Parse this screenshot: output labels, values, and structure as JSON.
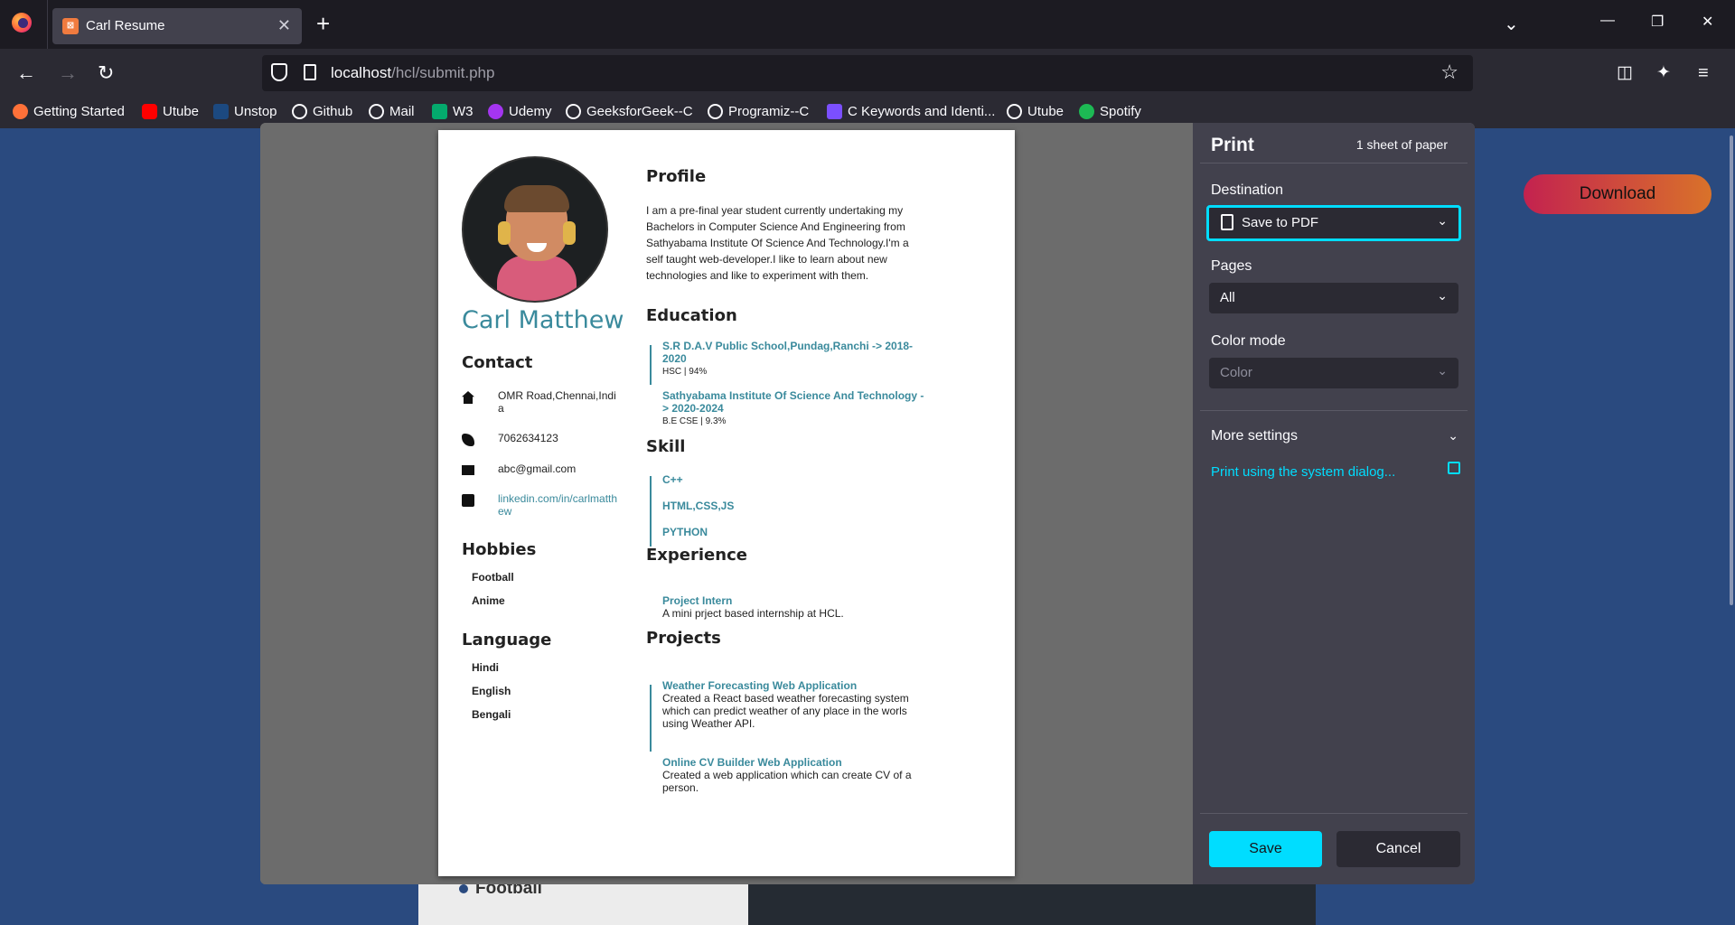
{
  "browser": {
    "tab_title": "Carl Resume",
    "tab_favicon": "xampp-icon",
    "tab_close": "✕",
    "new_tab": "+",
    "url_host": "localhost",
    "url_path": "/hcl/submit.php",
    "bookmarks": [
      {
        "label": "Getting Started",
        "icon": "firefox-icon",
        "color": "#ff7139"
      },
      {
        "label": "Utube",
        "icon": "youtube-icon",
        "color": "#ff0000"
      },
      {
        "label": "Unstop",
        "icon": "unstop-icon",
        "color": "#1c4980"
      },
      {
        "label": "Github",
        "icon": "github-icon",
        "color": "#fbfbfe"
      },
      {
        "label": "Mail",
        "icon": "globe-icon",
        "color": "#fbfbfe"
      },
      {
        "label": "W3",
        "icon": "w3-icon",
        "color": "#04aa6d"
      },
      {
        "label": "Udemy",
        "icon": "udemy-icon",
        "color": "#a435f0"
      },
      {
        "label": "GeeksforGeek--C",
        "icon": "globe-icon",
        "color": "#fbfbfe"
      },
      {
        "label": "Programiz--C",
        "icon": "globe-icon",
        "color": "#fbfbfe"
      },
      {
        "label": "C Keywords and Identi...",
        "icon": "programiz-icon",
        "color": "#7b4fff"
      },
      {
        "label": "Utube",
        "icon": "globe-icon",
        "color": "#fbfbfe"
      },
      {
        "label": "Spotify",
        "icon": "spotify-icon",
        "color": "#1db954"
      }
    ]
  },
  "page": {
    "download_label": "Download",
    "bg_hobby": "Football"
  },
  "print_dialog": {
    "title": "Print",
    "sheets": "1 sheet of paper",
    "destination_label": "Destination",
    "destination_value": "Save to PDF",
    "pages_label": "Pages",
    "pages_value": "All",
    "color_mode_label": "Color mode",
    "color_mode_value": "Color",
    "more_settings": "More settings",
    "system_dialog": "Print using the system dialog...",
    "save": "Save",
    "cancel": "Cancel",
    "accent": "#00ddff"
  },
  "resume": {
    "name": "Carl Matthew",
    "contact_heading": "Contact",
    "address": "OMR Road,Chennai,India",
    "phone": "7062634123",
    "email": "abc@gmail.com",
    "linkedin": "linkedin.com/in/carlmatthew",
    "hobbies_heading": "Hobbies",
    "hobbies": [
      "Football",
      "Anime"
    ],
    "language_heading": "Language",
    "languages": [
      "Hindi",
      "English",
      "Bengali"
    ],
    "profile_heading": "Profile",
    "profile_text": "I am a pre-final year student currently undertaking my Bachelors in Computer Science And Engineering from Sathyabama Institute Of Science And Technology.I'm a self taught web-developer.I like to learn about new technologies and like to experiment with them.",
    "education_heading": "Education",
    "education": [
      {
        "title": "S.R D.A.V Public School,Pundag,Ranchi -> 2018-2020",
        "sub": "HSC | 94%"
      },
      {
        "title": "Sathyabama Institute Of Science And Technology -> 2020-2024",
        "sub": "B.E CSE | 9.3%"
      }
    ],
    "skill_heading": "Skill",
    "skills": [
      "C++",
      "HTML,CSS,JS",
      "PYTHON"
    ],
    "experience_heading": "Experience",
    "experience": [
      {
        "title": "Project Intern",
        "desc": "A mini prject based internship at HCL."
      }
    ],
    "projects_heading": "Projects",
    "projects": [
      {
        "title": "Weather Forecasting Web Application",
        "desc": "Created a React based weather forecasting system which can predict weather of any place in the worls using Weather API."
      },
      {
        "title": "Online CV Builder Web Application",
        "desc": "Created a web application which can create CV of a person."
      }
    ],
    "accent": "#3a8a9c"
  }
}
